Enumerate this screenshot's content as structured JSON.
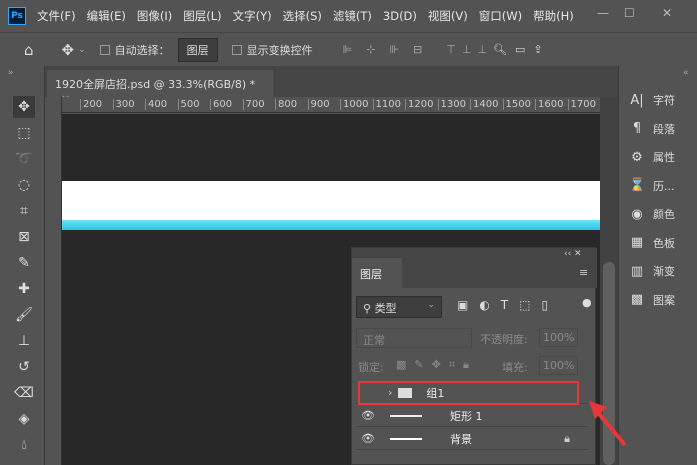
{
  "app": {
    "logo": "Ps"
  },
  "menu": [
    "文件(F)",
    "编辑(E)",
    "图像(I)",
    "图层(L)",
    "文字(Y)",
    "选择(S)",
    "滤镜(T)",
    "3D(D)",
    "视图(V)",
    "窗口(W)",
    "帮助(H)"
  ],
  "window_controls": {
    "minimize": "—",
    "maximize": "☐",
    "close": "✕"
  },
  "options": {
    "auto_select_label": "自动选择：",
    "auto_select_value": "图层",
    "show_transform_label": "显示变换控件"
  },
  "document": {
    "tab_title": "1920全屏店招.psd @ 33.3%(RGB/8) *",
    "close": "×"
  },
  "ruler": {
    "h_ticks": [
      "200",
      "300",
      "400",
      "500",
      "600",
      "700",
      "800",
      "900",
      "1000",
      "1100",
      "1200",
      "1300",
      "1400",
      "1500",
      "1600",
      "1700"
    ]
  },
  "right_panel": {
    "items": [
      {
        "icon": "A|",
        "label": "字符"
      },
      {
        "icon": "¶",
        "label": "段落"
      },
      {
        "icon": "⚙",
        "label": "属性"
      },
      {
        "icon": "⌛",
        "label": "历..."
      },
      {
        "icon": "◉",
        "label": "颜色"
      },
      {
        "icon": "▦",
        "label": "色板"
      },
      {
        "icon": "▥",
        "label": "渐变"
      },
      {
        "icon": "▩",
        "label": "图案"
      }
    ]
  },
  "layers_panel": {
    "tab": "图层",
    "filter_value": "类型",
    "blend_mode": "正常",
    "opacity_label": "不透明度:",
    "opacity_value": "100%",
    "lock_label": "锁定:",
    "fill_label": "填充:",
    "fill_value": "100%",
    "layers": [
      {
        "name": "组1",
        "type": "group",
        "visible": false,
        "highlighted": true
      },
      {
        "name": "矩形 1",
        "type": "shape",
        "visible": true
      },
      {
        "name": "背景",
        "type": "background",
        "visible": true,
        "locked": true
      }
    ]
  },
  "colors": {
    "highlight": "#e8363a",
    "arrow": "#e8363a",
    "canvas_accent": "#2fc4e8"
  }
}
